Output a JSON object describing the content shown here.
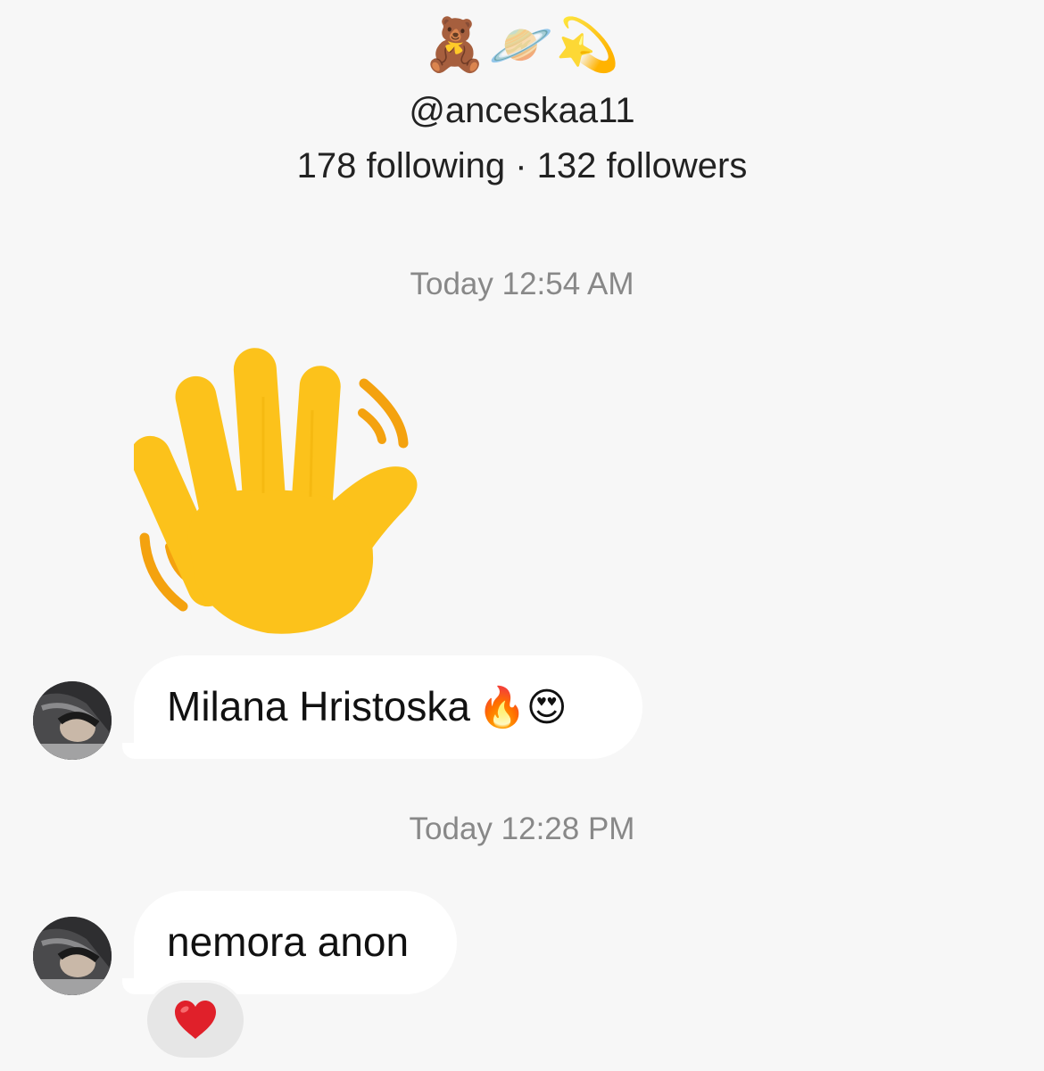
{
  "profile": {
    "emojis": "🧸🪐💫",
    "username": "@anceskaa11",
    "stats": "178 following · 132 followers"
  },
  "conversation": {
    "timestamp_1": "Today 12:54 AM",
    "sticker_icon": "waving-hand-icon",
    "message_1": {
      "text": "Milana Hristoska",
      "emojis": "🔥😍"
    },
    "timestamp_2": "Today 12:28 PM",
    "message_2": {
      "text": "nemora anon",
      "reaction": "❤️"
    }
  },
  "colors": {
    "background": "#f7f7f7",
    "bubble": "#ffffff",
    "reaction_bg": "#e6e6e6",
    "timestamp": "#888888",
    "heart": "#e0202a",
    "hand": "#fcc21b"
  }
}
